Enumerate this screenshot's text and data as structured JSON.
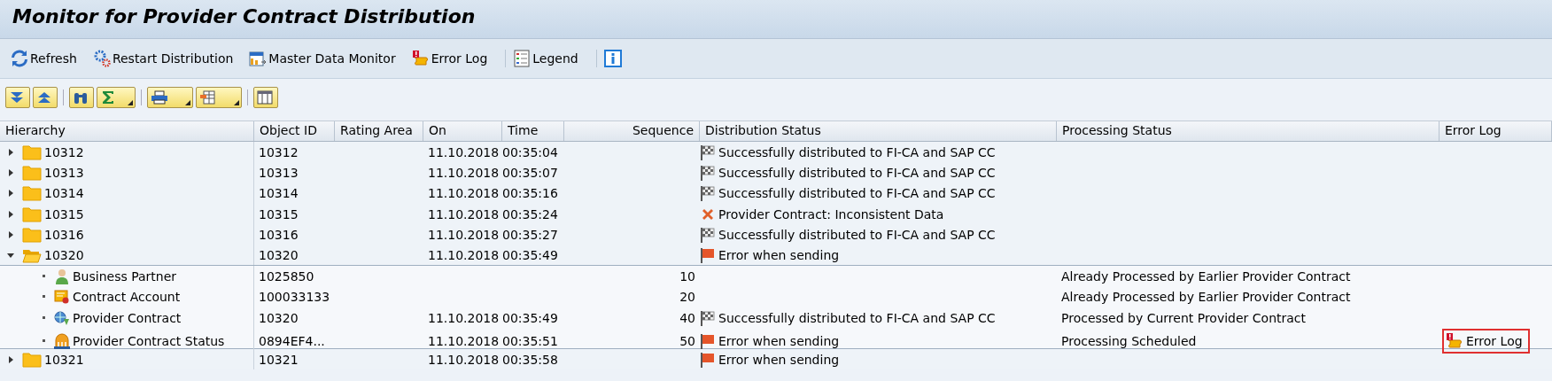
{
  "window": {
    "title": "Monitor for Provider Contract Distribution"
  },
  "toolbar": [
    {
      "kind": "refresh",
      "label": "Refresh"
    },
    {
      "kind": "restart",
      "label": "Restart Distribution"
    },
    {
      "kind": "master-data",
      "label": "Master Data Monitor"
    },
    {
      "kind": "error-log",
      "label": "Error Log"
    },
    {
      "kind": "legend",
      "label": "Legend"
    },
    {
      "kind": "info"
    }
  ],
  "table": {
    "columns": [
      "Hierarchy",
      "Object ID",
      "Rating Area",
      "On",
      "Time",
      "Sequence",
      "Distribution Status",
      "Processing Status",
      "Error Log"
    ],
    "rows": [
      {
        "kind": "folder",
        "label": "10312",
        "expanded": false,
        "object_id": "10312",
        "on": "11.10.2018",
        "time": "00:35:04",
        "status": {
          "kind": "success",
          "text": "Successfully distributed to FI-CA and SAP CC"
        }
      },
      {
        "kind": "folder",
        "label": "10313",
        "expanded": false,
        "object_id": "10313",
        "on": "11.10.2018",
        "time": "00:35:07",
        "status": {
          "kind": "success",
          "text": "Successfully distributed to FI-CA and SAP CC"
        }
      },
      {
        "kind": "folder",
        "label": "10314",
        "expanded": false,
        "object_id": "10314",
        "on": "11.10.2018",
        "time": "00:35:16",
        "status": {
          "kind": "success",
          "text": "Successfully distributed to FI-CA and SAP CC"
        }
      },
      {
        "kind": "folder",
        "label": "10315",
        "expanded": false,
        "object_id": "10315",
        "on": "11.10.2018",
        "time": "00:35:24",
        "status": {
          "kind": "inconsistent",
          "text": "Provider Contract: Inconsistent Data"
        }
      },
      {
        "kind": "folder",
        "label": "10316",
        "expanded": false,
        "object_id": "10316",
        "on": "11.10.2018",
        "time": "00:35:27",
        "status": {
          "kind": "success",
          "text": "Successfully distributed to FI-CA and SAP CC"
        }
      },
      {
        "kind": "folder",
        "label": "10320",
        "expanded": true,
        "object_id": "10320",
        "on": "11.10.2018",
        "time": "00:35:49",
        "status": {
          "kind": "error",
          "text": "Error when sending"
        },
        "children": [
          {
            "kind": "business-partner",
            "label": "Business Partner",
            "object_id": "1025850",
            "sequence": "10",
            "processing": "Already Processed by Earlier Provider Contract"
          },
          {
            "kind": "contract-account",
            "label": "Contract Account",
            "object_id": "100033133",
            "sequence": "20",
            "processing": "Already Processed by Earlier Provider Contract"
          },
          {
            "kind": "provider-contract",
            "label": "Provider Contract",
            "object_id": "10320",
            "on": "11.10.2018",
            "time": "00:35:49",
            "sequence": "40",
            "status": {
              "kind": "success",
              "text": "Successfully distributed to FI-CA and SAP CC"
            },
            "processing": "Processed by Current Provider Contract"
          },
          {
            "kind": "contract-status",
            "label": "Provider Contract Status",
            "object_id": "0894EF4...",
            "on": "11.10.2018",
            "time": "00:35:51",
            "sequence": "50",
            "status": {
              "kind": "error",
              "text": "Error when sending"
            },
            "processing": "Processing Scheduled",
            "error_log": {
              "label": "Error Log",
              "highlighted": true
            }
          }
        ]
      },
      {
        "kind": "folder",
        "label": "10321",
        "expanded": false,
        "object_id": "10321",
        "on": "11.10.2018",
        "time": "00:35:58",
        "status": {
          "kind": "error",
          "text": "Error when sending"
        }
      }
    ]
  }
}
